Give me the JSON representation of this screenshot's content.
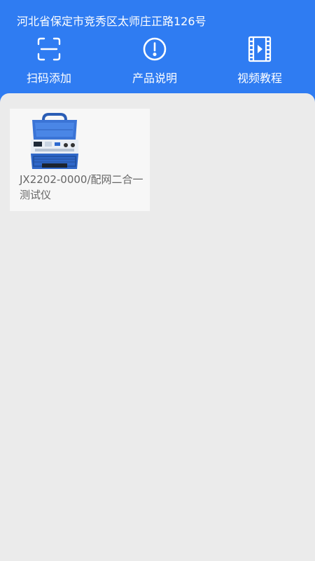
{
  "header": {
    "address": "河北省保定市竞秀区太师庄正路126号",
    "actions": [
      {
        "label": "扫码添加",
        "icon": "scan-icon"
      },
      {
        "label": "产品说明",
        "icon": "info-icon"
      },
      {
        "label": "视频教程",
        "icon": "video-icon"
      }
    ]
  },
  "products": [
    {
      "name": "JX2202-0000/配网二合一测试仪",
      "image": "tester-device-image"
    }
  ],
  "colors": {
    "header_bg": "#2f7cf2",
    "content_bg": "#ebebeb",
    "card_bg": "#f7f7f7",
    "product_text": "#666666"
  }
}
